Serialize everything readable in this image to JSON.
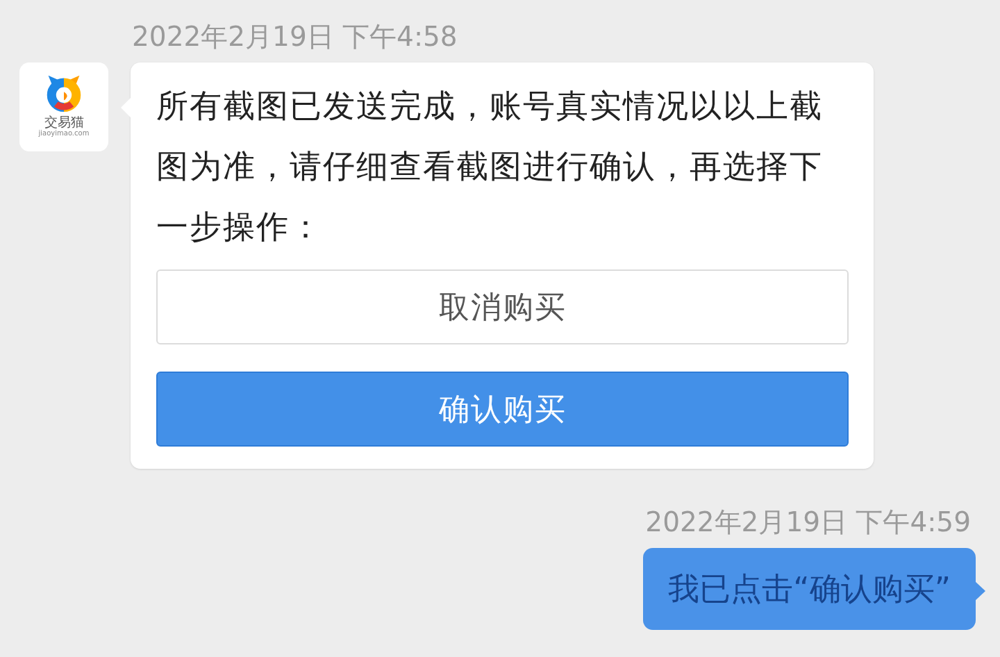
{
  "messages": [
    {
      "kind": "received",
      "timestamp": "2022年2月19日 下午4:58",
      "avatar": {
        "name": "交易猫",
        "site": "jiaoyimao.com"
      },
      "text": "所有截图已发送完成，账号真实情况以以上截图为准，请仔细查看截图进行确认，再选择下一步操作：",
      "buttons": [
        {
          "label": "取消购买",
          "kind": "secondary"
        },
        {
          "label": "确认购买",
          "kind": "primary"
        }
      ]
    },
    {
      "kind": "sent",
      "timestamp": "2022年2月19日 下午4:59",
      "text": "我已点击“确认购买”"
    }
  ]
}
